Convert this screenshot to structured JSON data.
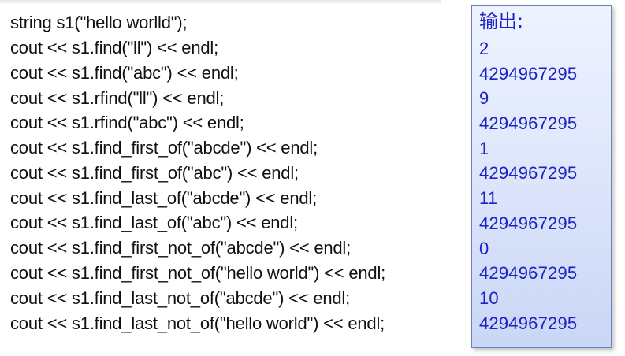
{
  "code_lines": [
    "string s1(\"hello worlld\");",
    "cout << s1.find(\"ll\") << endl;",
    "cout << s1.find(\"abc\") << endl;",
    "cout << s1.rfind(\"ll\") << endl;",
    "cout << s1.rfind(\"abc\") << endl;",
    "cout << s1.find_first_of(\"abcde\") << endl;",
    "cout << s1.find_first_of(\"abc\") << endl;",
    "cout << s1.find_last_of(\"abcde\") << endl;",
    "cout << s1.find_last_of(\"abc\") << endl;",
    "cout << s1.find_first_not_of(\"abcde\") << endl;",
    "cout << s1.find_first_not_of(\"hello world\") << endl;",
    "cout << s1.find_last_not_of(\"abcde\") << endl;",
    "cout << s1.find_last_not_of(\"hello world\") << endl;"
  ],
  "output": {
    "title": "输出:",
    "values": [
      "2",
      "4294967295",
      "9",
      "4294967295",
      "1",
      "4294967295",
      "11",
      "4294967295",
      "0",
      "4294967295",
      "10",
      "4294967295"
    ]
  },
  "colors": {
    "code_text": "#111111",
    "output_text": "#1c22c4",
    "output_border": "#6b84b8",
    "output_bg_top": "#eef3ff",
    "output_bg_bottom": "#c9d6f5"
  }
}
